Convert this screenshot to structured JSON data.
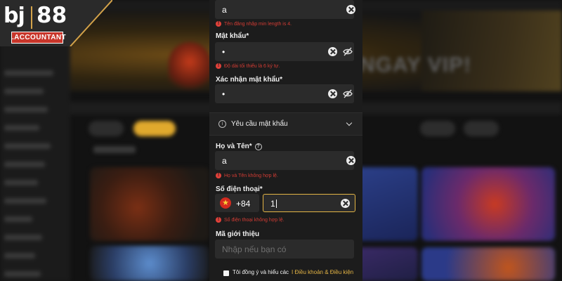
{
  "brand": {
    "logo_left": "bj",
    "logo_right": "88",
    "logo_tag": ".ACCOUNTANT"
  },
  "background": {
    "banner_text": "NGAY VIP!"
  },
  "form": {
    "username": {
      "value": "a",
      "error": "Tên đăng nhập min length is 4."
    },
    "password": {
      "label": "Mật khẩu*",
      "value": "•",
      "error": "Độ dài tối thiểu là 6 ký tự."
    },
    "confirm_password": {
      "label": "Xác nhận mật khẩu*",
      "value": "•"
    },
    "password_requirements": {
      "label": "Yêu cầu mật khẩu"
    },
    "full_name": {
      "label": "Họ và Tên*",
      "value": "a",
      "error": "Họ và Tên không hợp lệ."
    },
    "phone": {
      "label": "Số điện thoại*",
      "country_code": "+84",
      "value": "1",
      "error": "Số điện thoại không hợp lệ."
    },
    "referral": {
      "label": "Mã giới thiệu",
      "placeholder": "Nhập nếu bạn có"
    },
    "agreement": {
      "text": "Tôi đồng ý và hiểu các",
      "link": "Điều khoản & Điều kiện"
    }
  },
  "colors": {
    "accent": "#e3b445",
    "error": "#e1413a",
    "modal_bg": "#1c1c1c",
    "field_bg": "#2b2b2b"
  }
}
